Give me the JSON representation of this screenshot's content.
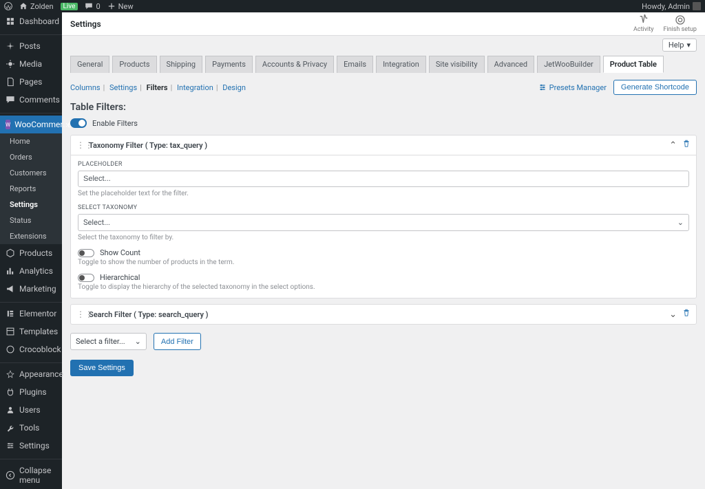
{
  "adminbar": {
    "site_name": "Zolden",
    "live_badge": "Live",
    "comments_count": "0",
    "new_label": "New",
    "greeting": "Howdy, Admin"
  },
  "sidebar": {
    "items": [
      {
        "label": "Dashboard",
        "icon": "dashboard"
      },
      {
        "label": "Posts",
        "icon": "pin"
      },
      {
        "label": "Media",
        "icon": "media"
      },
      {
        "label": "Pages",
        "icon": "pages"
      },
      {
        "label": "Comments",
        "icon": "comments"
      },
      {
        "label": "WooCommerce",
        "icon": "woo",
        "current": true
      },
      {
        "label": "Products",
        "icon": "products"
      },
      {
        "label": "Analytics",
        "icon": "analytics"
      },
      {
        "label": "Marketing",
        "icon": "marketing"
      },
      {
        "label": "Elementor",
        "icon": "elementor"
      },
      {
        "label": "Templates",
        "icon": "templates"
      },
      {
        "label": "Crocoblock",
        "icon": "crocoblock"
      },
      {
        "label": "Appearance",
        "icon": "appearance"
      },
      {
        "label": "Plugins",
        "icon": "plugins"
      },
      {
        "label": "Users",
        "icon": "users"
      },
      {
        "label": "Tools",
        "icon": "tools"
      },
      {
        "label": "Settings",
        "icon": "settings"
      },
      {
        "label": "Collapse menu",
        "icon": "collapse"
      }
    ],
    "submenu": [
      "Home",
      "Orders",
      "Customers",
      "Reports",
      "Settings",
      "Status",
      "Extensions"
    ],
    "submenu_active": "Settings"
  },
  "header": {
    "title": "Settings",
    "activity_label": "Activity",
    "finish_label": "Finish setup",
    "help_label": "Help"
  },
  "nav_tabs": [
    "General",
    "Products",
    "Shipping",
    "Payments",
    "Accounts & Privacy",
    "Emails",
    "Integration",
    "Site visibility",
    "Advanced",
    "JetWooBuilder",
    "Product Table"
  ],
  "nav_active": "Product Table",
  "subsections": [
    "Columns",
    "Settings",
    "Filters",
    "Integration",
    "Design"
  ],
  "subsections_active": "Filters",
  "presets_label": "Presets Manager",
  "generate_label": "Generate Shortcode",
  "section_title": "Table Filters:",
  "enable_filters_label": "Enable Filters",
  "filter1": {
    "title": "Taxonomy Filter ( Type: tax_query )",
    "placeholder_label": "PLACEHOLDER",
    "placeholder_value": "Select...",
    "placeholder_help": "Set the placeholder text for the filter.",
    "taxonomy_label": "SELECT TAXONOMY",
    "taxonomy_value": "Select...",
    "taxonomy_help": "Select the taxonomy to filter by.",
    "show_count_label": "Show Count",
    "show_count_help": "Toggle to show the number of products in the term.",
    "hierarchical_label": "Hierarchical",
    "hierarchical_help": "Toggle to display the hierarchy of the selected taxonomy in the select options."
  },
  "filter2": {
    "title": "Search Filter ( Type: search_query )"
  },
  "add_filter_select": "Select a filter...",
  "add_filter_btn": "Add Filter",
  "save_btn": "Save Settings"
}
